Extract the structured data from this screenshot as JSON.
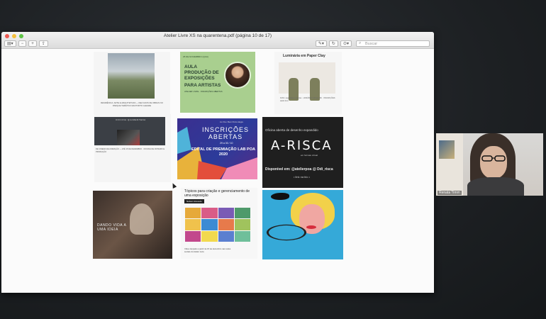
{
  "window": {
    "title": "Atelier Livre XS na quarentena.pdf (página 10 de 17)",
    "search_placeholder": "Buscar",
    "tools": {
      "sidebar": "▤▾",
      "zoom_out": "−",
      "zoom_in": "+",
      "share": "⇪",
      "markup": "✎▾",
      "rotate": "↻",
      "annotate": "⊙▾"
    }
  },
  "tiles": {
    "t1": {
      "text": "RESIDÊNCIA: ARTE E ARQUITETURA — DEZ ANOS DE OBRAS NO PARQUE TEMÁTICO EM PORTO ALEGRE"
    },
    "t2": {
      "date": "25 DE NOVEMBRO (QUA)",
      "title": "AULA PRODUÇÃO DE EXPOSIÇÕES",
      "subtitle": "PARA ARTISTAS",
      "note": "ATELIER LIVRE · INSCRIÇÕES ABERTAS"
    },
    "t3": {
      "title": "Luminária em Paper Clay",
      "info": "DIAS: segundas e quartas · HORÁRIO: 14h às 16h · INSCRIÇÕES: ateliê livre"
    },
    "t4": {
      "header": "OFICINA QUARENTENA",
      "info": "DE CINEMA DE ANIMAÇÃO — ATÉ 15 DE DEZEMBRO · OFICINA DE ROTEIRO E PRODUÇÃO"
    },
    "t5": {
      "top": "Ao Vivo: Bem Porto Alegre",
      "title": "INSCRIÇÕES ABERTAS",
      "dates": "29 a 30 / 10",
      "edital": "EDITAL DE PREMIAÇÃO LAB POA 2020"
    },
    "t6": {
      "line1": "Oficina aberta de desenho expandido",
      "title": "A-RISCA",
      "small": "em formato virtual",
      "available": "Disponível em: @atelierpoa @ Ddi_risca",
      "link": "• link na bio •"
    },
    "t7": {
      "text": "DANDO VIDA A UMA IDEIA"
    },
    "t8": {
      "title": "Tópicos para criação e gerenciamento de uma exposição",
      "badge": "Nelson Azevedo",
      "foot": "Vídeo lançado a partir de 15 de dezembro nas redes sociais do Atelier Livre"
    }
  },
  "video": {
    "name": "Renata Timm"
  },
  "colors": {
    "grid": [
      "#e6a93a",
      "#d95c87",
      "#7a5bb5",
      "#4f9a6b",
      "#f0c24c",
      "#3c8bd3",
      "#e77a4b",
      "#a0c35d",
      "#c2488c",
      "#f2d94e",
      "#5b7fd0",
      "#6fbf9a"
    ]
  }
}
